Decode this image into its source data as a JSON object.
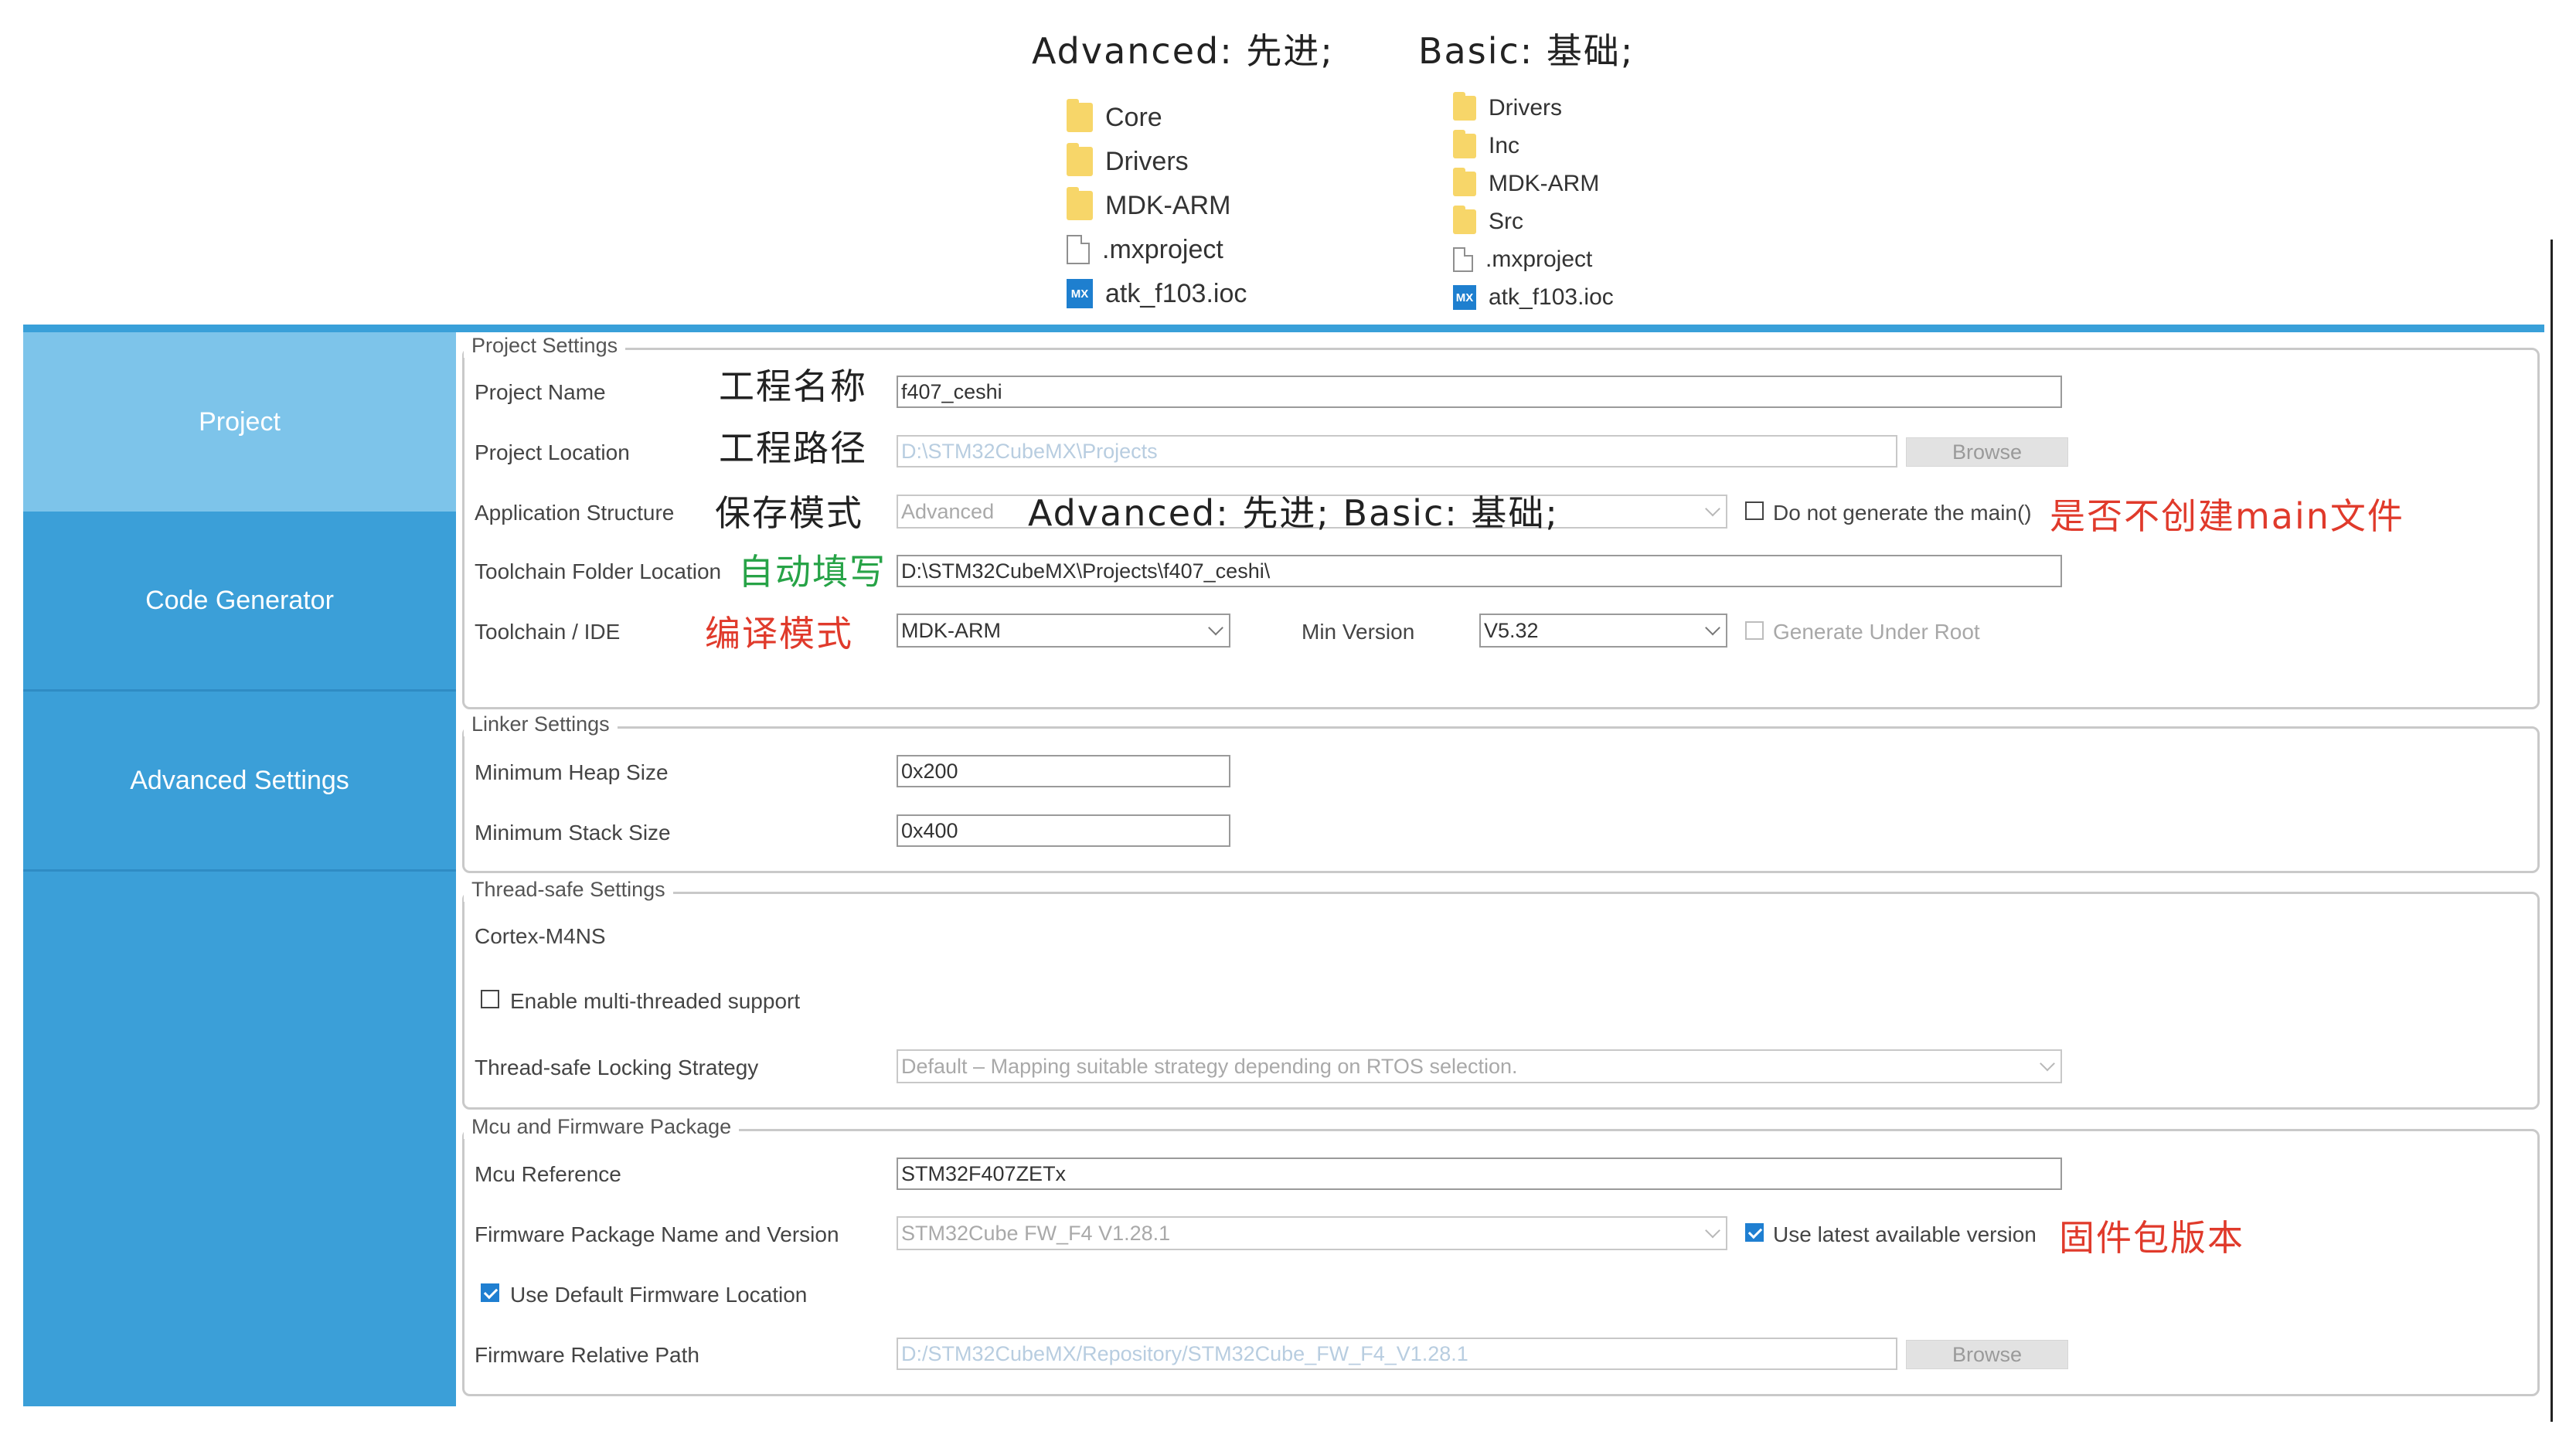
{
  "top_annotations": {
    "advanced": "Advanced: 先进;",
    "basic": "Basic: 基础;"
  },
  "folder_advanced": [
    {
      "icon": "folder-icon",
      "name": "Core"
    },
    {
      "icon": "folder-icon",
      "name": "Drivers"
    },
    {
      "icon": "folder-icon",
      "name": "MDK-ARM"
    },
    {
      "icon": "file-icon",
      "name": ".mxproject"
    },
    {
      "icon": "mx-file-icon",
      "name": "atk_f103.ioc",
      "badge": "MX"
    }
  ],
  "folder_basic": [
    {
      "icon": "folder-icon",
      "name": "Drivers"
    },
    {
      "icon": "folder-icon",
      "name": "Inc"
    },
    {
      "icon": "folder-icon",
      "name": "MDK-ARM"
    },
    {
      "icon": "folder-icon",
      "name": "Src"
    },
    {
      "icon": "file-icon",
      "name": ".mxproject"
    },
    {
      "icon": "mx-file-icon",
      "name": "atk_f103.ioc",
      "badge": "MX"
    }
  ],
  "sidebar": {
    "items": [
      {
        "label": "Project",
        "active": true
      },
      {
        "label": "Code Generator",
        "active": false
      },
      {
        "label": "Advanced Settings",
        "active": false
      }
    ]
  },
  "project_settings": {
    "title": "Project Settings",
    "project_name_label": "Project Name",
    "project_name_value": "f407_ceshi",
    "project_location_label": "Project Location",
    "project_location_value": "D:\\STM32CubeMX\\Projects",
    "browse_label": "Browse",
    "app_structure_label": "Application Structure",
    "app_structure_value": "Advanced",
    "do_not_generate_main_label": "Do not generate the main()",
    "toolchain_folder_label": "Toolchain Folder Location",
    "toolchain_folder_value": "D:\\STM32CubeMX\\Projects\\f407_ceshi\\",
    "toolchain_ide_label": "Toolchain / IDE",
    "toolchain_ide_value": "MDK-ARM",
    "min_version_label": "Min Version",
    "min_version_value": "V5.32",
    "generate_under_root_label": "Generate Under Root"
  },
  "annotations": {
    "project_name": "工程名称",
    "project_location": "工程路径",
    "app_structure": "保存模式",
    "app_structure_inline": "Advanced: 先进; Basic: 基础;",
    "do_not_generate_main": "是否不创建main文件",
    "toolchain_folder": "自动填写",
    "toolchain_ide": "编译模式",
    "firmware_version": "固件包版本"
  },
  "linker_settings": {
    "title": "Linker Settings",
    "heap_label": "Minimum Heap Size",
    "heap_value": "0x200",
    "stack_label": "Minimum Stack Size",
    "stack_value": "0x400"
  },
  "thread_safe": {
    "title": "Thread-safe Settings",
    "core": "Cortex-M4NS",
    "enable_label": "Enable multi-threaded support",
    "strategy_label": "Thread-safe Locking Strategy",
    "strategy_value": "Default  –  Mapping suitable strategy depending on RTOS selection."
  },
  "mcu_firmware": {
    "title": "Mcu and Firmware Package",
    "mcu_ref_label": "Mcu Reference",
    "mcu_ref_value": "STM32F407ZETx",
    "fw_label": "Firmware Package Name and Version",
    "fw_value": "STM32Cube FW_F4 V1.28.1",
    "use_latest_label": "Use latest available version",
    "use_default_label": "Use Default Firmware Location",
    "fw_path_label": "Firmware Relative Path",
    "fw_path_value": "D:/STM32CubeMX/Repository/STM32Cube_FW_F4_V1.28.1",
    "browse_label": "Browse"
  },
  "colors": {
    "sidebar": "#3b9fd8",
    "sidebar_active": "#7dc4ea",
    "annotation_red": "#e03a2b",
    "annotation_green": "#27a347",
    "checkbox_checked": "#1f7fd1"
  }
}
